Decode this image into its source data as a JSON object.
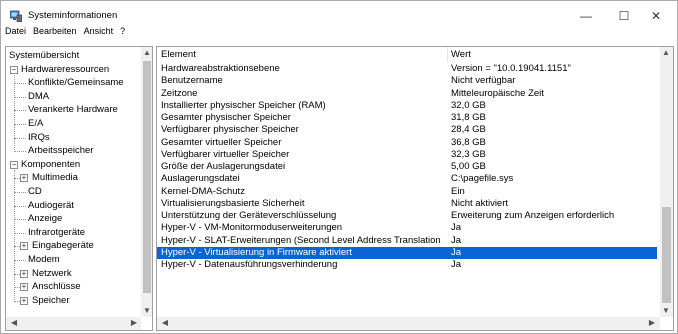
{
  "window": {
    "title": "Systeminformationen",
    "controls": {
      "minimize": "—",
      "maximize": "☐",
      "close": "✕"
    }
  },
  "menu": [
    "Datei",
    "Bearbeiten",
    "Ansicht",
    "?"
  ],
  "tree": [
    {
      "label": "Systemübersicht",
      "level": 0,
      "expander": ""
    },
    {
      "label": "Hardwareressourcen",
      "level": 0,
      "expander": "−"
    },
    {
      "label": "Konflikte/Gemeinsame",
      "level": 1,
      "expander": ""
    },
    {
      "label": "DMA",
      "level": 1,
      "expander": ""
    },
    {
      "label": "Verankerte Hardware",
      "level": 1,
      "expander": ""
    },
    {
      "label": "E/A",
      "level": 1,
      "expander": ""
    },
    {
      "label": "IRQs",
      "level": 1,
      "expander": ""
    },
    {
      "label": "Arbeitsspeicher",
      "level": 1,
      "expander": ""
    },
    {
      "label": "Komponenten",
      "level": 0,
      "expander": "−"
    },
    {
      "label": "Multimedia",
      "level": 1,
      "expander": "+"
    },
    {
      "label": "CD",
      "level": 1,
      "expander": ""
    },
    {
      "label": "Audiogerät",
      "level": 1,
      "expander": ""
    },
    {
      "label": "Anzeige",
      "level": 1,
      "expander": ""
    },
    {
      "label": "Infrarotgeräte",
      "level": 1,
      "expander": ""
    },
    {
      "label": "Eingabegeräte",
      "level": 1,
      "expander": "+"
    },
    {
      "label": "Modem",
      "level": 1,
      "expander": ""
    },
    {
      "label": "Netzwerk",
      "level": 1,
      "expander": "+"
    },
    {
      "label": "Anschlüsse",
      "level": 1,
      "expander": "+"
    },
    {
      "label": "Speicher",
      "level": 1,
      "expander": "+"
    }
  ],
  "columns": {
    "element": "Element",
    "value": "Wert"
  },
  "rows": [
    {
      "element": "Hardwareabstraktionsebene",
      "value": "Version = \"10.0.19041.1151\""
    },
    {
      "element": "Benutzername",
      "value": "Nicht verfügbar"
    },
    {
      "element": "Zeitzone",
      "value": "Mitteleuropäische Zeit"
    },
    {
      "element": "Installierter physischer Speicher (RAM)",
      "value": "32,0 GB"
    },
    {
      "element": "Gesamter physischer Speicher",
      "value": "31,8 GB"
    },
    {
      "element": "Verfügbarer physischer Speicher",
      "value": "28,4 GB"
    },
    {
      "element": "Gesamter virtueller Speicher",
      "value": "36,8 GB"
    },
    {
      "element": "Verfügbarer virtueller Speicher",
      "value": "32,3 GB"
    },
    {
      "element": "Größe der Auslagerungsdatei",
      "value": "5,00 GB"
    },
    {
      "element": "Auslagerungsdatei",
      "value": "C:\\pagefile.sys"
    },
    {
      "element": "Kernel-DMA-Schutz",
      "value": "Ein"
    },
    {
      "element": "Virtualisierungsbasierte Sicherheit",
      "value": "Nicht aktiviert"
    },
    {
      "element": "Unterstützung der Geräteverschlüsselung",
      "value": "Erweiterung zum Anzeigen erforderlich"
    },
    {
      "element": "Hyper-V - VM-Monitormoduserweiterungen",
      "value": "Ja"
    },
    {
      "element": "Hyper-V - SLAT-Erweiterungen (Second Level Address Translation)",
      "value": "Ja"
    },
    {
      "element": "Hyper-V - Virtualisierung in Firmware aktiviert",
      "value": "Ja",
      "selected": true
    },
    {
      "element": "Hyper-V - Datenausführungsverhinderung",
      "value": "Ja"
    }
  ],
  "scroll_arrows": {
    "up": "▲",
    "down": "▼",
    "left": "◀",
    "right": "▶"
  },
  "colors": {
    "selection": "#0a64d7",
    "selection_text": "#ffffff"
  }
}
